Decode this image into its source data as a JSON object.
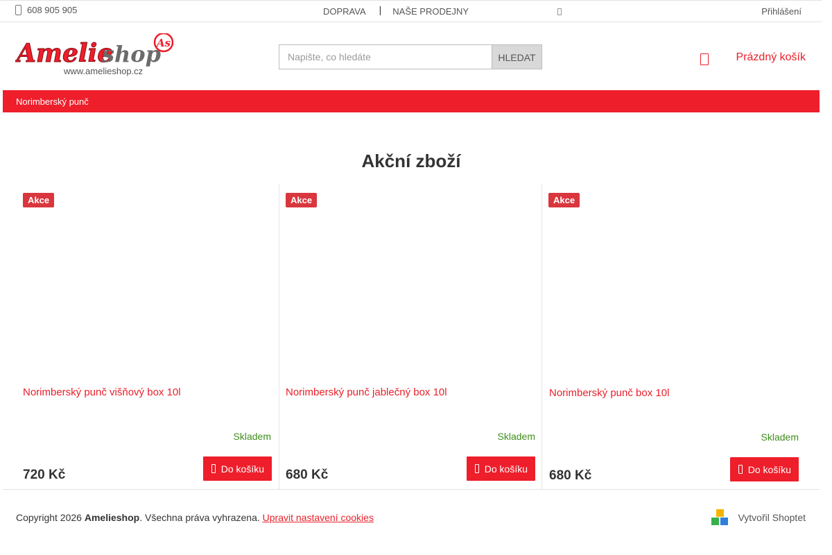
{
  "topbar": {
    "phone": "608 905 905",
    "nav": [
      "DOPRAVA",
      "NAŠE PRODEJNY"
    ],
    "separator": "|",
    "login": "Přihlášení"
  },
  "header": {
    "logo_text": "Amelieshop",
    "logo_mark": "As",
    "logo_url_text": "www.amelieshop.cz",
    "search_placeholder": "Napište, co hledáte",
    "search_button": "HLEDAT",
    "cart_label": "Prázdný košík"
  },
  "navbar": {
    "items": [
      "Norimberský punč"
    ]
  },
  "main": {
    "heading": "Akční zboží",
    "products": [
      {
        "badge": "Akce",
        "name": "Norimberský punč višňový box 10l",
        "stock": "Skladem",
        "price": "720 Kč",
        "button": "Do košíku"
      },
      {
        "badge": "Akce",
        "name": "Norimberský punč jablečný box 10l",
        "stock": "Skladem",
        "price": "680 Kč",
        "button": "Do košíku"
      },
      {
        "badge": "Akce",
        "name": "Norimberský punč box 10l",
        "stock": "Skladem",
        "price": "680 Kč",
        "button": "Do košíku"
      }
    ]
  },
  "footer": {
    "copyright_prefix": "Copyright 2026 ",
    "brand": "Amelieshop",
    "rights": ". Všechna práva vyhrazena. ",
    "cookies_link": "Upravit nastavení cookies",
    "shoptet": "Vytvořil Shoptet"
  },
  "colors": {
    "accent": "#ee1e2b",
    "link": "#e8202a",
    "stock": "#3e8e1c",
    "badge": "#d9363e"
  }
}
